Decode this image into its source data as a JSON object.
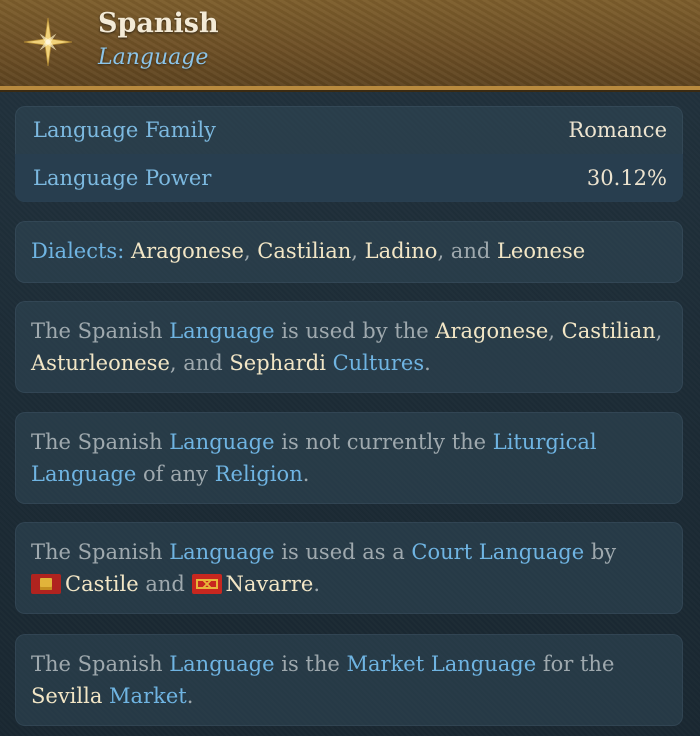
{
  "header": {
    "title": "Spanish",
    "subtitle": "Language",
    "icon": "compass-star-icon",
    "accent": "#b88a3e"
  },
  "stats": [
    {
      "label": "Language Family",
      "value": "Romance"
    },
    {
      "label": "Language Power",
      "value": "30.12%"
    }
  ],
  "dialects": {
    "label": "Dialects:",
    "items": [
      "Aragonese",
      "Castilian",
      "Ladino",
      "Leonese"
    ],
    "sep1": ", ",
    "sep2": ", ",
    "sep3": ", and "
  },
  "cultures": {
    "t1": "The Spanish ",
    "t2": "Language",
    "t3": " is used by the ",
    "c1": "Aragonese",
    "s1": ", ",
    "c2": "Castilian",
    "s2": ",",
    "c3": "Asturleonese",
    "s3": ", and ",
    "c4": "Sephardi",
    "s4": " ",
    "t4": "Cultures",
    "t5": "."
  },
  "liturgy": {
    "t1": "The Spanish ",
    "t2": "Language",
    "t3": " is not currently the ",
    "t4": "Liturgical",
    "t5": "Language",
    "t6": " of any ",
    "t7": "Religion",
    "t8": "."
  },
  "court": {
    "t1": "The Spanish ",
    "t2": "Language",
    "t3": " is used as a ",
    "t4": "Court Language",
    "t5": " by",
    "country1": "Castile",
    "and": " and ",
    "country2": "Navarre",
    "end": "."
  },
  "market": {
    "t1": "The Spanish ",
    "t2": "Language",
    "t3": " is the ",
    "t4": "Market Language",
    "t5": " for the",
    "place": "Sevilla",
    "t6": " ",
    "t7": "Market",
    "t8": "."
  }
}
